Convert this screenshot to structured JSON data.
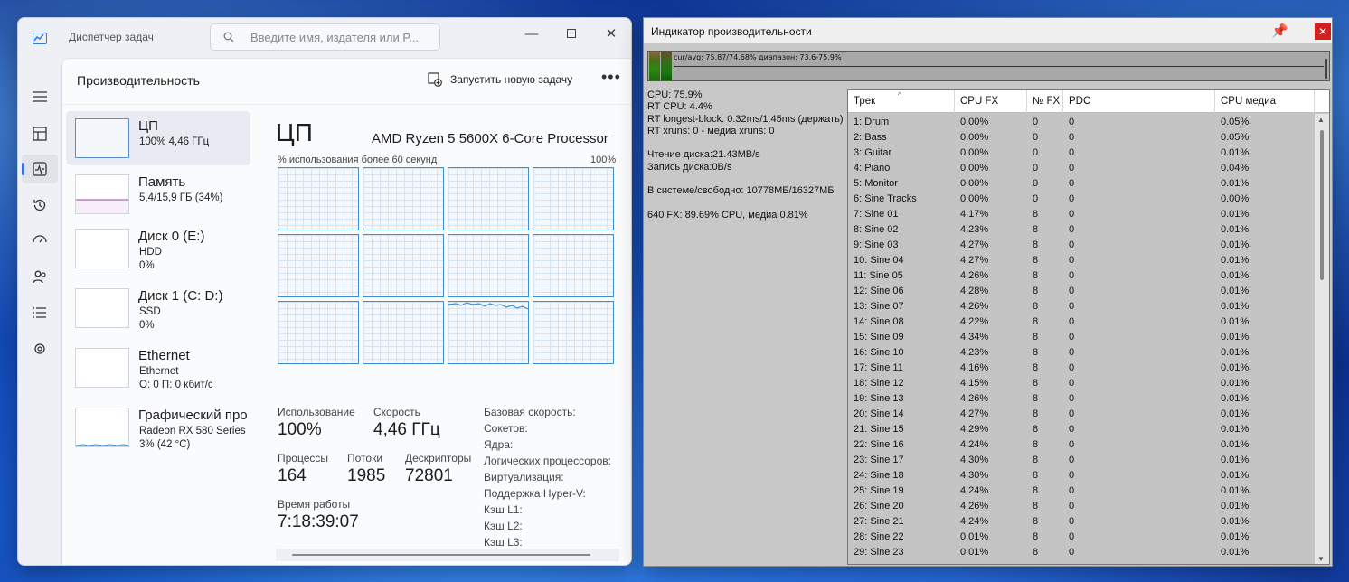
{
  "task_manager": {
    "title": "Диспетчер задач",
    "search_placeholder": "Введите имя, издателя или P...",
    "header": "Производительность",
    "run_new_task": "Запустить новую задачу",
    "resources": [
      {
        "name": "ЦП",
        "sub": "100% 4,46 ГГц",
        "sub2": ""
      },
      {
        "name": "Память",
        "sub": "5,4/15,9 ГБ (34%)",
        "sub2": ""
      },
      {
        "name": "Диск 0 (E:)",
        "sub": "HDD",
        "sub2": "0%"
      },
      {
        "name": "Диск 1 (C: D:)",
        "sub": "SSD",
        "sub2": "0%"
      },
      {
        "name": "Ethernet",
        "sub": "Ethernet",
        "sub2": "О: 0 П: 0 кбит/с"
      },
      {
        "name": "Графический про",
        "sub": "Radeon RX 580 Series",
        "sub2": "3% (42 °C)"
      }
    ],
    "cpu": {
      "big": "ЦП",
      "model": "AMD Ryzen 5 5600X 6-Core Processor",
      "caption": "% использования более 60 секунд",
      "max": "100%"
    },
    "stats": {
      "usage_label": "Использование",
      "usage_value": "100%",
      "speed_label": "Скорость",
      "speed_value": "4,46 ГГц",
      "processes_label": "Процессы",
      "processes_value": "164",
      "threads_label": "Потоки",
      "threads_value": "1985",
      "handles_label": "Дескрипторы",
      "handles_value": "72801",
      "uptime_label": "Время работы",
      "uptime_value": "7:18:39:07",
      "right_labels": [
        "Базовая скорость:",
        "Сокетов:",
        "Ядра:",
        "Логических процессоров:",
        "Виртуализация:",
        "Поддержка Hyper-V:",
        "Кэш L1:",
        "Кэш L2:",
        "Кэш L3:"
      ]
    }
  },
  "perf_meter": {
    "title": "Индикатор производительности",
    "graph_text": "cur/avg: 75.87/74.68%  диапазон: 73.6-75.9%",
    "info": [
      "CPU: 75.9%",
      "RT CPU: 4.4%",
      "RT longest-block: 0.32ms/1.45ms (держать)",
      "RT xruns: 0 - медиа xruns: 0",
      "",
      "Чтение диска:21.43MB/s",
      "Запись диска:0B/s",
      "",
      "В системе/свободно: 10778МБ/16327МБ",
      "",
      "640 FX: 89.69% CPU, медиа 0.81%"
    ],
    "columns": [
      "Трек",
      "CPU FX",
      "№ FX",
      "PDC",
      "CPU медиа"
    ],
    "rows": [
      [
        "1: Drum",
        "0.00%",
        "0",
        "0",
        "0.05%"
      ],
      [
        "2: Bass",
        "0.00%",
        "0",
        "0",
        "0.05%"
      ],
      [
        "3: Guitar",
        "0.00%",
        "0",
        "0",
        "0.01%"
      ],
      [
        "4: Piano",
        "0.00%",
        "0",
        "0",
        "0.04%"
      ],
      [
        "5: Monitor",
        "0.00%",
        "0",
        "0",
        "0.01%"
      ],
      [
        "6: Sine Tracks",
        "0.00%",
        "0",
        "0",
        "0.00%"
      ],
      [
        "7: Sine 01",
        "4.17%",
        "8",
        "0",
        "0.01%"
      ],
      [
        "8: Sine 02",
        "4.23%",
        "8",
        "0",
        "0.01%"
      ],
      [
        "9: Sine 03",
        "4.27%",
        "8",
        "0",
        "0.01%"
      ],
      [
        "10: Sine 04",
        "4.27%",
        "8",
        "0",
        "0.01%"
      ],
      [
        "11: Sine 05",
        "4.26%",
        "8",
        "0",
        "0.01%"
      ],
      [
        "12: Sine 06",
        "4.28%",
        "8",
        "0",
        "0.01%"
      ],
      [
        "13: Sine 07",
        "4.26%",
        "8",
        "0",
        "0.01%"
      ],
      [
        "14: Sine 08",
        "4.22%",
        "8",
        "0",
        "0.01%"
      ],
      [
        "15: Sine 09",
        "4.34%",
        "8",
        "0",
        "0.01%"
      ],
      [
        "16: Sine 10",
        "4.23%",
        "8",
        "0",
        "0.01%"
      ],
      [
        "17: Sine 11",
        "4.16%",
        "8",
        "0",
        "0.01%"
      ],
      [
        "18: Sine 12",
        "4.15%",
        "8",
        "0",
        "0.01%"
      ],
      [
        "19: Sine 13",
        "4.26%",
        "8",
        "0",
        "0.01%"
      ],
      [
        "20: Sine 14",
        "4.27%",
        "8",
        "0",
        "0.01%"
      ],
      [
        "21: Sine 15",
        "4.29%",
        "8",
        "0",
        "0.01%"
      ],
      [
        "22: Sine 16",
        "4.24%",
        "8",
        "0",
        "0.01%"
      ],
      [
        "23: Sine 17",
        "4.30%",
        "8",
        "0",
        "0.01%"
      ],
      [
        "24: Sine 18",
        "4.30%",
        "8",
        "0",
        "0.01%"
      ],
      [
        "25: Sine 19",
        "4.24%",
        "8",
        "0",
        "0.01%"
      ],
      [
        "26: Sine 20",
        "4.26%",
        "8",
        "0",
        "0.01%"
      ],
      [
        "27: Sine 21",
        "4.24%",
        "8",
        "0",
        "0.01%"
      ],
      [
        "28: Sine 22",
        "0.01%",
        "8",
        "0",
        "0.01%"
      ],
      [
        "29: Sine 23",
        "0.01%",
        "8",
        "0",
        "0.01%"
      ]
    ]
  },
  "colors": {
    "accent_blue": "#3a6ee0",
    "cpu_graph_line": "#3f8ed3",
    "memory_graph": "#9b3ea8",
    "pm_close": "#d21f1f"
  }
}
